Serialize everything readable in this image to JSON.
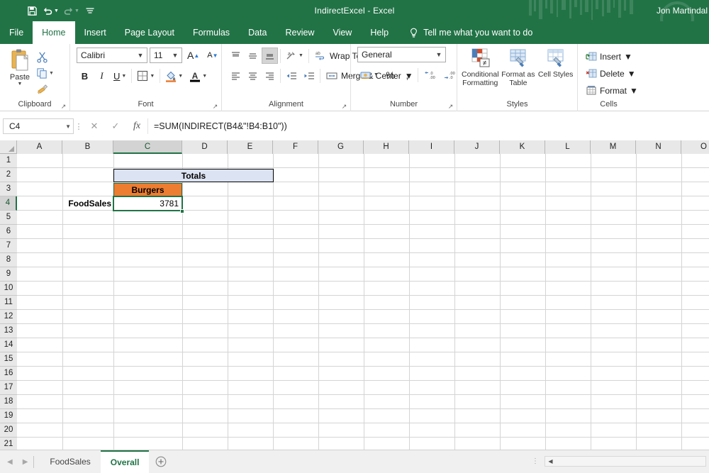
{
  "titlebar": {
    "document_title": "IndirectExcel  -  Excel",
    "user_name": "Jon Martindal",
    "qat": [
      {
        "name": "save",
        "icon": "save-icon",
        "label": "Save"
      },
      {
        "name": "undo",
        "icon": "undo-icon",
        "label": "Undo"
      },
      {
        "name": "redo",
        "icon": "redo-icon",
        "label": "Redo"
      },
      {
        "name": "customize",
        "icon": "customize-quick-access-icon",
        "label": "Customize Quick Access Toolbar"
      }
    ]
  },
  "ribbon_tabs": [
    {
      "label": "File",
      "active": false
    },
    {
      "label": "Home",
      "active": true
    },
    {
      "label": "Insert",
      "active": false
    },
    {
      "label": "Page Layout",
      "active": false
    },
    {
      "label": "Formulas",
      "active": false
    },
    {
      "label": "Data",
      "active": false
    },
    {
      "label": "Review",
      "active": false
    },
    {
      "label": "View",
      "active": false
    },
    {
      "label": "Help",
      "active": false
    }
  ],
  "tell_me": {
    "label": "Tell me what you want to do",
    "icon": "lightbulb-icon"
  },
  "ribbon": {
    "clipboard": {
      "group_label": "Clipboard",
      "paste_label": "Paste",
      "cut_label": "Cut",
      "copy_label": "Copy",
      "format_painter_label": "Format Painter"
    },
    "font": {
      "group_label": "Font",
      "font_name": "Calibri",
      "font_size": "11",
      "bold_label": "B",
      "italic_label": "I",
      "underline_label": "U",
      "increase_font_label": "A",
      "decrease_font_label": "A",
      "borders_label": "Borders",
      "fill_color_label": "Fill Color",
      "font_color_label": "Font Color"
    },
    "alignment": {
      "group_label": "Alignment",
      "wrap_text_label": "Wrap Text",
      "merge_center_label": "Merge & Center",
      "orientation_label": "Orientation",
      "top_align_label": "Top Align",
      "middle_align_label": "Middle Align",
      "bottom_align_label": "Bottom Align",
      "align_left_label": "Align Left",
      "align_center_label": "Center",
      "align_right_label": "Align Right",
      "decrease_indent_label": "Decrease Indent",
      "increase_indent_label": "Increase Indent"
    },
    "number": {
      "group_label": "Number",
      "format": "General",
      "accounting_label": "Accounting Number Format",
      "percent_label": "%",
      "comma_label": ",",
      "increase_decimal_label": "Increase Decimal",
      "decrease_decimal_label": "Decrease Decimal"
    },
    "styles": {
      "group_label": "Styles",
      "conditional_formatting_label": "Conditional Formatting",
      "format_as_table_label": "Format as Table",
      "cell_styles_label": "Cell Styles"
    },
    "cells": {
      "group_label": "Cells",
      "insert_label": "Insert",
      "delete_label": "Delete",
      "format_label": "Format"
    }
  },
  "formula_bar": {
    "name_box": "C4",
    "formula": "=SUM(INDIRECT(B4&\"!B4:B10\"))",
    "cancel_label": "Cancel",
    "enter_label": "Enter",
    "insert_function_label": "fx"
  },
  "grid": {
    "columns": [
      "A",
      "B",
      "C",
      "D",
      "E",
      "F",
      "G",
      "H",
      "I",
      "J",
      "K",
      "L",
      "M",
      "N",
      "O"
    ],
    "selected_column": "C",
    "rows": [
      "1",
      "2",
      "3",
      "4",
      "5",
      "6",
      "7",
      "8",
      "9",
      "10",
      "11",
      "12",
      "13",
      "14",
      "15",
      "16",
      "17",
      "18",
      "19",
      "20",
      "21"
    ],
    "selected_row": "4",
    "selected_cell": "C4",
    "cells": {
      "b4": "FoodSales",
      "c2_merged": "Totals",
      "c3": "Burgers",
      "c4": "3781"
    },
    "colors": {
      "totals_fill": "#dce3f2",
      "burgers_fill": "#ed7d31",
      "selection_border": "#217346",
      "accent": "#217346"
    }
  },
  "sheet_tabs": {
    "prev_label": "Previous Sheet",
    "next_label": "Next Sheet",
    "tabs": [
      {
        "label": "FoodSales",
        "active": false
      },
      {
        "label": "Overall",
        "active": true
      }
    ],
    "add_sheet_label": "New sheet"
  }
}
